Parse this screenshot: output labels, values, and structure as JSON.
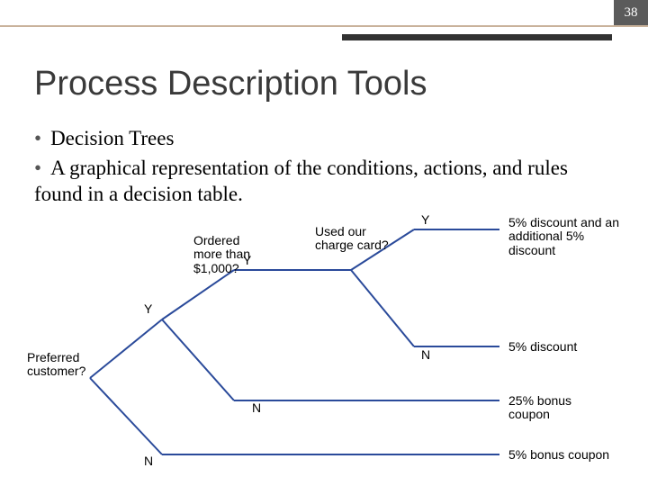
{
  "page_number": "38",
  "title": "Process Description Tools",
  "bullets": [
    "Decision Trees",
    "A graphical representation of the conditions, actions, and rules found in a decision table."
  ],
  "tree": {
    "q1": "Preferred customer?",
    "q2": "Ordered more than $1,000?",
    "q3": "Used our charge card?",
    "yes": "Y",
    "no": "N",
    "out1": "5% discount and an additional 5% discount",
    "out2": "5% discount",
    "out3": "25% bonus coupon",
    "out4": "5% bonus coupon"
  }
}
